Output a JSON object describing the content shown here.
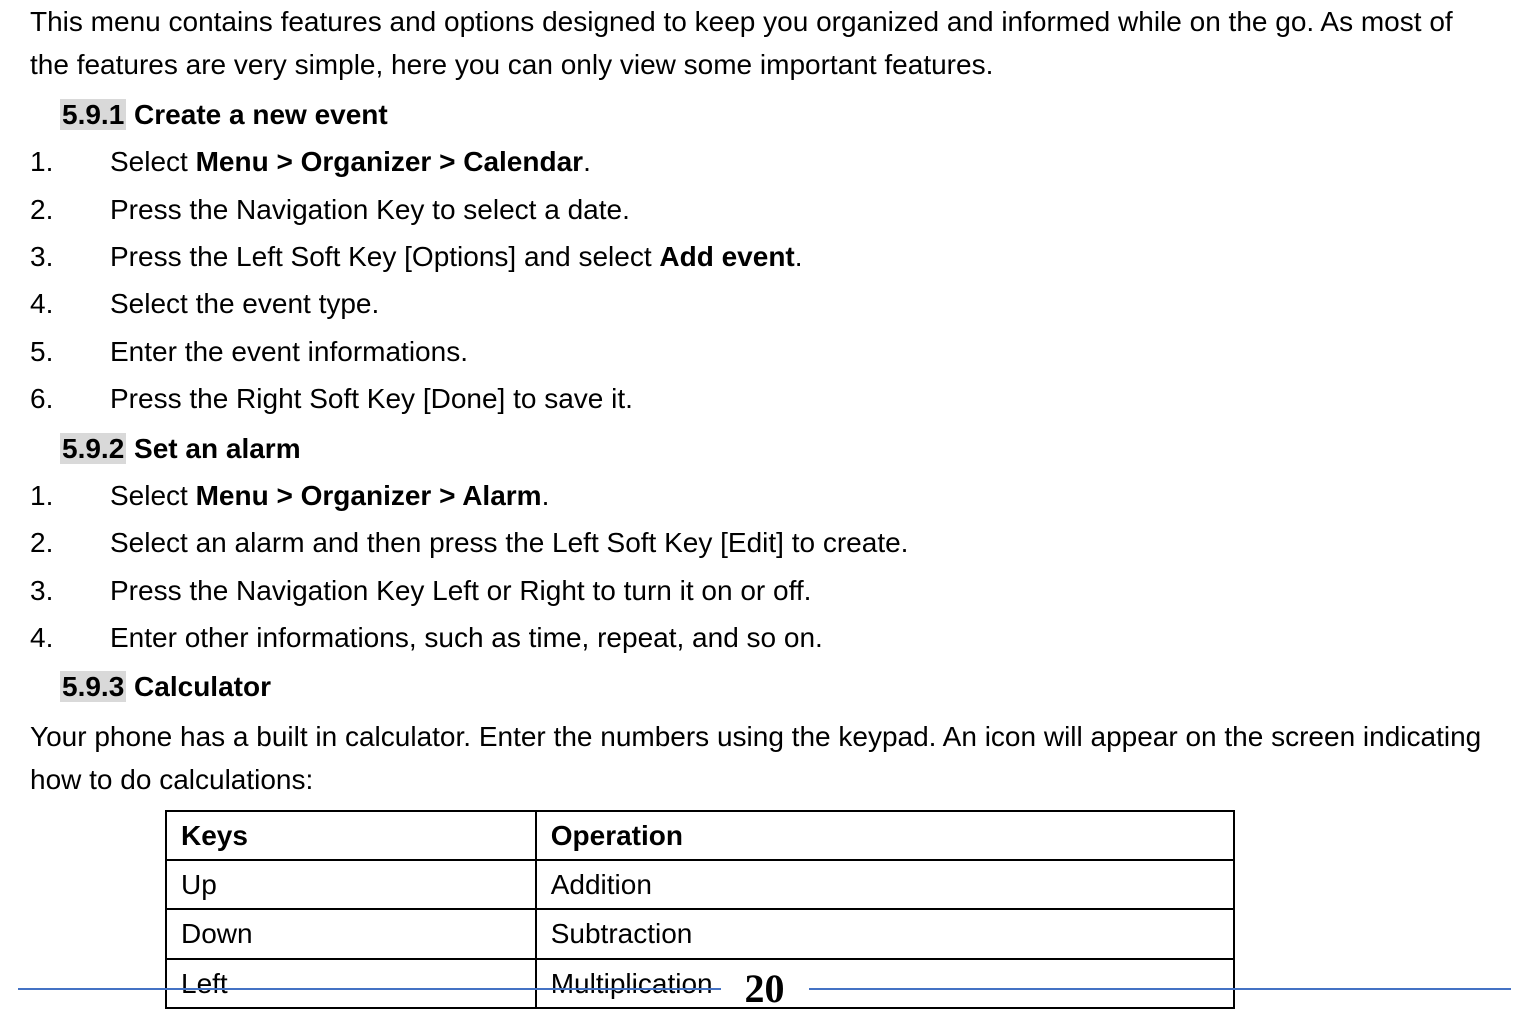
{
  "intro": {
    "line1": "This menu contains features and options designed to keep you organized and informed while on the go.",
    "line2": "As most of the features are very simple, here you can only view some important features."
  },
  "sections": {
    "s1": {
      "number": "5.9.1",
      "title": " Create a new event",
      "steps": [
        {
          "num": "1.",
          "pre": "Select ",
          "bold": "Menu > Organizer > Calendar",
          "post": "."
        },
        {
          "num": "2.",
          "pre": "Press the Navigation Key to select a date.",
          "bold": "",
          "post": ""
        },
        {
          "num": "3.",
          "pre": "Press the Left Soft Key [Options] and select ",
          "bold": "Add event",
          "post": "."
        },
        {
          "num": "4.",
          "pre": "Select the event type.",
          "bold": "",
          "post": ""
        },
        {
          "num": "5.",
          "pre": "Enter the event informations.",
          "bold": "",
          "post": ""
        },
        {
          "num": "6.",
          "pre": "Press the Right Soft Key [Done] to save it.",
          "bold": "",
          "post": ""
        }
      ]
    },
    "s2": {
      "number": "5.9.2",
      "title": "  Set an alarm",
      "steps": [
        {
          "num": "1.",
          "pre": "Select ",
          "bold": "Menu > Organizer > Alarm",
          "post": "."
        },
        {
          "num": "2.",
          "pre": "Select an alarm and then press the Left Soft Key [Edit] to create.",
          "bold": "",
          "post": ""
        },
        {
          "num": "3.",
          "pre": "Press the Navigation Key Left or Right to turn it on or off.",
          "bold": "",
          "post": ""
        },
        {
          "num": "4.",
          "pre": "Enter other informations, such as time, repeat, and so on.",
          "bold": "",
          "post": ""
        }
      ]
    },
    "s3": {
      "number": "5.9.3",
      "title": " Calculator",
      "para": "Your phone has a built in calculator. Enter the numbers using the keypad. An icon will appear on the screen indicating how to do calculations:"
    }
  },
  "table": {
    "headers": {
      "col1": "Keys",
      "col2": "Operation"
    },
    "rows": [
      {
        "key": "Up",
        "op": "Addition"
      },
      {
        "key": "Down",
        "op": "Subtraction"
      },
      {
        "key": "Left",
        "op": "Multiplication"
      }
    ]
  },
  "page_number": "20"
}
